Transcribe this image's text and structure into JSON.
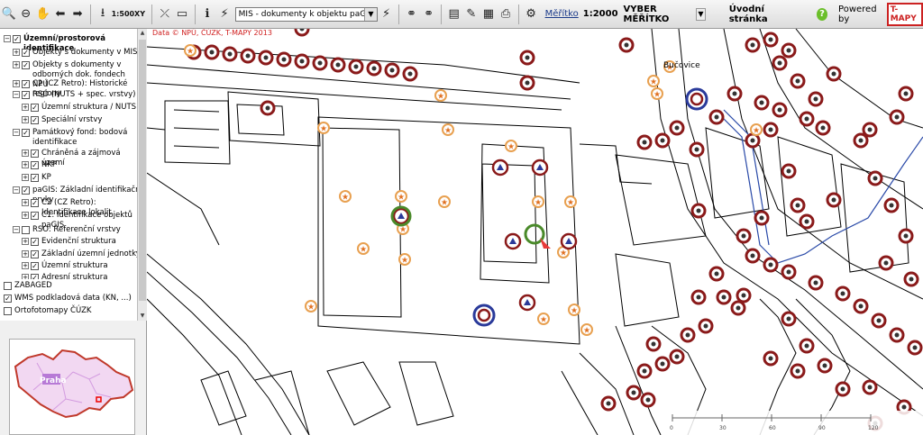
{
  "toolbar": {
    "scale_text": "1:500",
    "xy_text": "XY",
    "layer_select_value": "MIS - dokumenty k objektu paGIS",
    "scale_label": "Měřítko",
    "scale_value": "1:2000",
    "scale_select": "VYBER MĚŘÍTKO",
    "home": "Úvodní stránka",
    "help": "?",
    "powered": "Powered by",
    "logo": "T-MAPY"
  },
  "tree": [
    {
      "label": "Územní/prostorová identifikace",
      "exp": "⊟",
      "checked": true
    },
    {
      "label": "Objekty s dokumenty v MIS",
      "exp": "⊞",
      "checked": true
    },
    {
      "label": "Objekty s dokumenty v odborných dok. fondech NPÚ",
      "exp": "⊞",
      "checked": true
    },
    {
      "label": "C2 (CZ Retro): Historické regiony",
      "exp": "⊞",
      "checked": true
    },
    {
      "label": "RSO (NUTS + spec. vrstvy)",
      "exp": "⊟",
      "checked": true
    },
    {
      "label": "Územní struktura / NUTS",
      "exp": "⊞",
      "checked": true
    },
    {
      "label": "Speciální vrstvy",
      "exp": "⊞",
      "checked": true
    },
    {
      "label": "Památkový fond: bodová identifikace",
      "exp": "⊟",
      "checked": true
    },
    {
      "label": "Chráněná a zájmová území",
      "exp": "⊞",
      "checked": true
    },
    {
      "label": "NKP",
      "exp": "⊞",
      "checked": true
    },
    {
      "label": "KP",
      "exp": "⊞",
      "checked": true
    },
    {
      "label": "paGIS: Základní identifikační prvky",
      "exp": "⊟",
      "checked": true
    },
    {
      "label": "C2 (CZ Retro): Identifikace lokalit",
      "exp": "⊞",
      "checked": true
    },
    {
      "label": "C1: Identifikace objektů paGIS",
      "exp": "⊞",
      "checked": true
    },
    {
      "label": "RSO: Referenční vrstvy",
      "exp": "⊟",
      "checked": false
    },
    {
      "label": "Evidenční struktura",
      "exp": "⊞",
      "checked": true
    },
    {
      "label": "Základní územní jednotky",
      "exp": "⊞",
      "checked": true
    },
    {
      "label": "Územní struktura",
      "exp": "⊞",
      "checked": true
    },
    {
      "label": "Adresní struktura",
      "exp": "⊞",
      "checked": true
    }
  ],
  "bottom_items": [
    {
      "label": "ZABAGED",
      "checked": false
    },
    {
      "label": "WMS podkladová data (KN, ...)",
      "checked": true
    },
    {
      "label": "Ortofotomapy ČÚZK",
      "checked": false
    }
  ],
  "overview": {
    "city": "Praha"
  },
  "map": {
    "cuzk_text": "Data © NPÚ, ČÚZK, T-MAPY 2013",
    "town": "Bučovice",
    "scale_ticks": [
      "0",
      "30",
      "60",
      "90",
      "120"
    ]
  }
}
